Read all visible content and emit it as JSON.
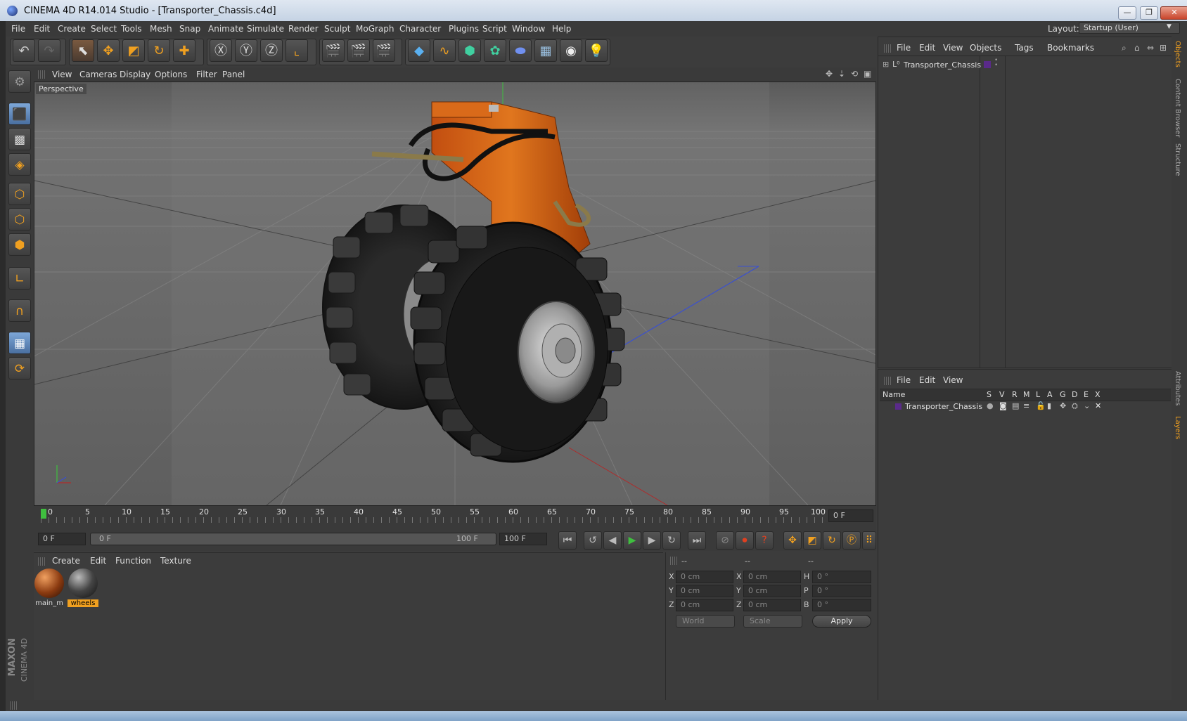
{
  "window": {
    "title": "CINEMA 4D R14.014 Studio - [Transporter_Chassis.c4d]",
    "minimize": "—",
    "restore": "❐",
    "close": "✕"
  },
  "menubar": {
    "items": [
      "File",
      "Edit",
      "Create",
      "Select",
      "Tools",
      "Mesh",
      "Snap",
      "Animate",
      "Simulate",
      "Render",
      "Sculpt",
      "MoGraph",
      "Character",
      "Plugins",
      "Script",
      "Window",
      "Help"
    ],
    "layout_label": "Layout:",
    "layout_value": "Startup (User)"
  },
  "viewport": {
    "menu": [
      "View",
      "Cameras",
      "Display",
      "Options",
      "Filter",
      "Panel"
    ],
    "label": "Perspective"
  },
  "timeline": {
    "ticks": [
      "0",
      "5",
      "10",
      "15",
      "20",
      "25",
      "30",
      "35",
      "40",
      "45",
      "50",
      "55",
      "60",
      "65",
      "70",
      "75",
      "80",
      "85",
      "90",
      "95",
      "100"
    ],
    "current_frame": "0 F",
    "start_field": "0 F",
    "slider_start": "0 F",
    "slider_end": "100 F",
    "end_field": "100 F"
  },
  "material_manager": {
    "menu": [
      "Create",
      "Edit",
      "Function",
      "Texture"
    ],
    "materials": [
      {
        "name": "main_m",
        "selected": false
      },
      {
        "name": "wheels",
        "selected": true
      }
    ]
  },
  "coordinates": {
    "headers": [
      "--",
      "--",
      "--"
    ],
    "rows": [
      {
        "a": "X",
        "av": "0 cm",
        "b": "X",
        "bv": "0 cm",
        "c": "H",
        "cv": "0 °"
      },
      {
        "a": "Y",
        "av": "0 cm",
        "b": "Y",
        "bv": "0 cm",
        "c": "P",
        "cv": "0 °"
      },
      {
        "a": "Z",
        "av": "0 cm",
        "b": "Z",
        "bv": "0 cm",
        "c": "B",
        "cv": "0 °"
      }
    ],
    "mode": "World",
    "type": "Scale",
    "apply": "Apply"
  },
  "object_manager": {
    "menu": [
      "File",
      "Edit",
      "View",
      "Objects",
      "Tags",
      "Bookmarks"
    ],
    "object": "Transporter_Chassis"
  },
  "layer_manager": {
    "menu": [
      "File",
      "Edit",
      "View"
    ],
    "columns": [
      "Name",
      "S",
      "V",
      "R",
      "M",
      "L",
      "A",
      "G",
      "D",
      "E",
      "X"
    ],
    "layer": "Transporter_Chassis"
  },
  "side_tabs": {
    "top": [
      "Objects",
      "Content Browser",
      "Structure"
    ],
    "bottom": [
      "Attributes",
      "Layers"
    ]
  },
  "branding": {
    "maxon": "MAXON",
    "cinema": "CINEMA 4D"
  },
  "colors": {
    "accent": "#f0a020",
    "panel": "#3c3c3c",
    "layer_color": "#5a2a8a"
  }
}
